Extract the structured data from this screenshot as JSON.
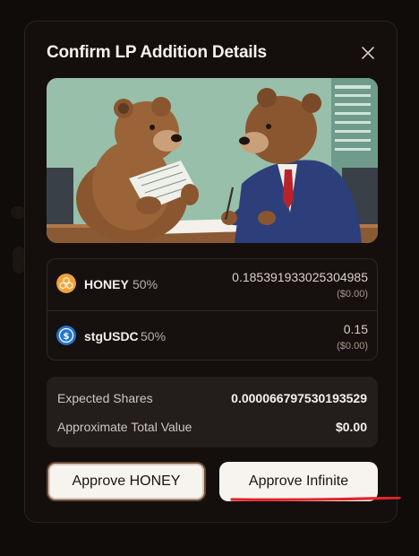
{
  "modal": {
    "title": "Confirm LP Addition Details",
    "close_icon": "close-icon"
  },
  "tokens": [
    {
      "symbol": "HONEY",
      "percent": "50%",
      "amount": "0.185391933025304985",
      "usd": "($0.00)",
      "icon": "honey-token-icon",
      "color": "#f1a23a"
    },
    {
      "symbol": "stgUSDC",
      "percent": "50%",
      "amount": "0.15",
      "usd": "($0.00)",
      "icon": "usdc-token-icon",
      "color": "#2775ca"
    }
  ],
  "summary": {
    "expected_shares_label": "Expected Shares",
    "expected_shares_value": "0.000066797530193529",
    "total_value_label": "Approximate Total Value",
    "total_value_value": "$0.00"
  },
  "buttons": {
    "approve_honey": "Approve HONEY",
    "approve_infinite": "Approve Infinite"
  },
  "colors": {
    "modal_bg": "#140f0c",
    "annotation_red": "#e0252a"
  }
}
